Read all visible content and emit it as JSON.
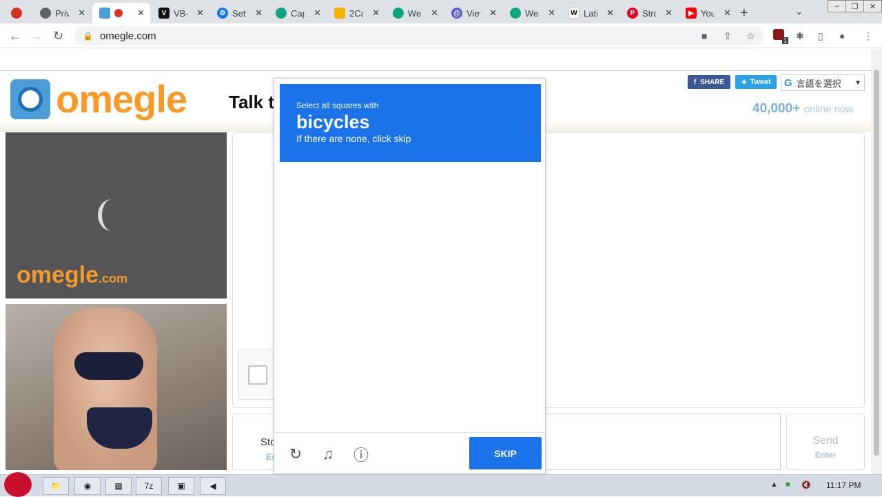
{
  "browser": {
    "tabs": [
      {
        "title": "",
        "icon": "recording-icon"
      },
      {
        "title": "Priv",
        "icon": "globe-icon"
      },
      {
        "title": "",
        "icon": "omegle-icon",
        "active": true
      },
      {
        "title": "VB-",
        "icon": "vb-icon"
      },
      {
        "title": "Sett",
        "icon": "gear-icon"
      },
      {
        "title": "Cap",
        "icon": "openai-icon"
      },
      {
        "title": "2Ca",
        "icon": "2captcha-icon"
      },
      {
        "title": "We",
        "icon": "openai-icon"
      },
      {
        "title": "Viev",
        "icon": "at-icon"
      },
      {
        "title": "We",
        "icon": "openai-icon"
      },
      {
        "title": "Lati",
        "icon": "wikipedia-icon"
      },
      {
        "title": "Stro",
        "icon": "pinterest-icon"
      },
      {
        "title": "You",
        "icon": "youtube-icon"
      }
    ],
    "url": "omegle.com",
    "extension_badge": "1"
  },
  "site": {
    "logo_text": "omegle",
    "tagline": "Talk t",
    "share_label": "SHARE",
    "tweet_label": "Tweet",
    "translate_label": "言語を選択",
    "online_count": "40,000+",
    "online_text": "online now",
    "watermark": "omegle",
    "watermark_suffix": ".com",
    "stop_label": "Sto",
    "stop_hint": "Es",
    "send_label": "Send",
    "send_hint": "Enter"
  },
  "captcha": {
    "instruction": "Select all squares with",
    "target": "bicycles",
    "note": "If there are none, click skip",
    "skip_label": "SKIP",
    "grid_rows": 4,
    "grid_cols": 4
  },
  "taskbar": {
    "clock": "11:17 PM"
  }
}
